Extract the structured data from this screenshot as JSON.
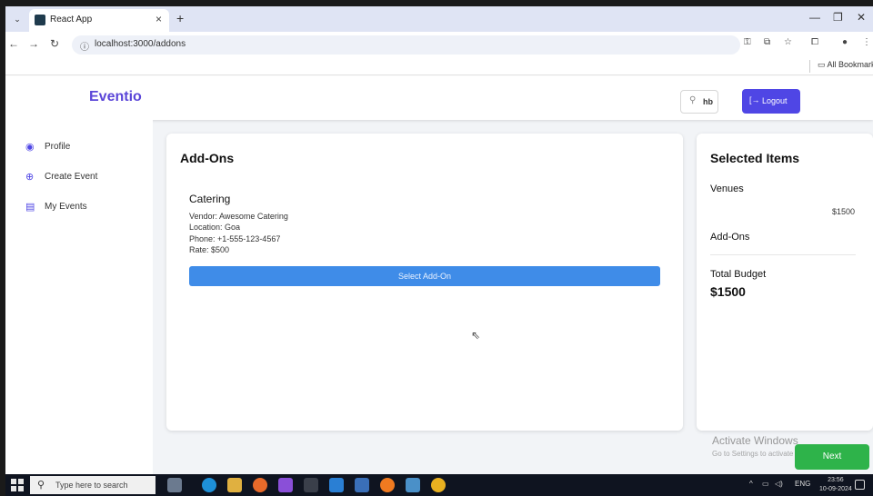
{
  "browser": {
    "tab_title": "React App",
    "tab_close": "×",
    "new_tab": "+",
    "url": "localhost:3000/addons",
    "bookmarks_label": "All Bookmarks"
  },
  "app": {
    "brand": "Eventio",
    "user_name": "hb",
    "logout_label": "Logout",
    "sidebar": {
      "items": [
        {
          "label": "Profile",
          "icon": "user-circle-icon"
        },
        {
          "label": "Create Event",
          "icon": "plus-circle-icon"
        },
        {
          "label": "My Events",
          "icon": "calendar-icon"
        }
      ]
    },
    "addons": {
      "title": "Add-Ons",
      "item": {
        "name": "Catering",
        "vendor": "Vendor: Awesome Catering",
        "location": "Location: Goa",
        "phone": "Phone: +1-555-123-4567",
        "rate": "Rate: $500",
        "button_label": "Select Add-On"
      }
    },
    "selected": {
      "title": "Selected Items",
      "venues_label": "Venues",
      "venue_price": "$1500",
      "addons_label": "Add-Ons",
      "budget_label": "Total Budget",
      "budget_value": "$1500"
    },
    "next_label": "Next"
  },
  "watermark": {
    "title": "Activate Windows",
    "subtitle": "Go to Settings to activate Windows."
  },
  "taskbar": {
    "search_placeholder": "Type here to search",
    "lang": "ENG",
    "time": "23:56",
    "date": "10-09-2024"
  },
  "colors": {
    "brand": "#5b46d8",
    "logout": "#4f46e5",
    "select_button": "#3f8ce8",
    "next_button": "#2eb34a"
  }
}
